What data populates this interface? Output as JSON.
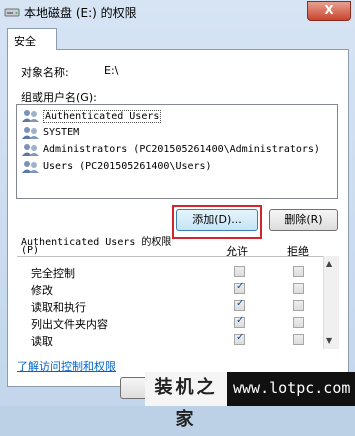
{
  "window": {
    "title": "本地磁盘 (E:) 的权限",
    "close_label": "X"
  },
  "tab": {
    "label": "安全"
  },
  "object": {
    "label": "对象名称:",
    "value": "E:\\"
  },
  "groups": {
    "label": "组或用户名(G):",
    "items": [
      {
        "name": "Authenticated Users"
      },
      {
        "name": "SYSTEM"
      },
      {
        "name": "Administrators (PC201505261400\\Administrators)"
      },
      {
        "name": "Users (PC201505261400\\Users)"
      }
    ]
  },
  "buttons": {
    "add": "添加(D)...",
    "remove": "删除(R)"
  },
  "permissions": {
    "title": "Authenticated Users 的权限",
    "title_key": "(P)",
    "col_allow": "允许",
    "col_deny": "拒绝",
    "rows": [
      {
        "name": "完全控制",
        "allow": false,
        "deny": false
      },
      {
        "name": "修改",
        "allow": true,
        "deny": false
      },
      {
        "name": "读取和执行",
        "allow": true,
        "deny": false
      },
      {
        "name": "列出文件夹内容",
        "allow": true,
        "deny": false
      },
      {
        "name": "读取",
        "allow": true,
        "deny": false
      }
    ]
  },
  "link": {
    "label": "了解访问控制和权限"
  },
  "watermark": {
    "cn": "装机之家",
    "url": "www.lotpc.com"
  }
}
